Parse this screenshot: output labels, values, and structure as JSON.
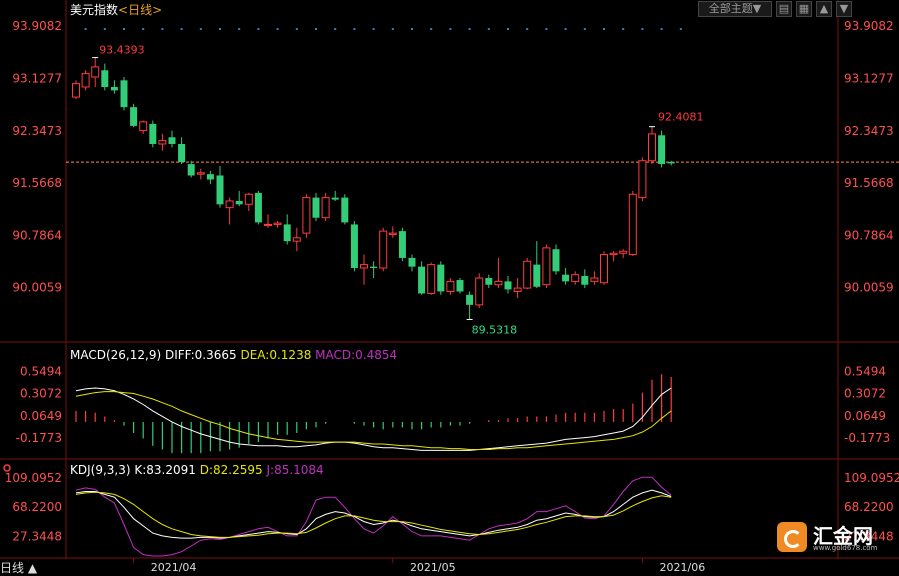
{
  "header": {
    "instrument": "美元指数",
    "period": "<日线>",
    "theme_label": "全部主题▼"
  },
  "price_panel": {
    "y_ticks": [
      "93.9082",
      "93.1277",
      "92.3473",
      "91.5668",
      "90.7864",
      "90.0059"
    ],
    "high_label": "93.4393",
    "low_label": "89.5318",
    "last_high_label": "92.4081",
    "dashed_level": 91.88
  },
  "macd_panel": {
    "title": "MACD(26,12,9)",
    "diff_label": "DIFF:0.3665",
    "dea_label": "DEA:0.1238",
    "macd_label": "MACD:0.4854",
    "y_ticks": [
      "0.5494",
      "0.3072",
      "0.0649",
      "-0.1773"
    ]
  },
  "kdj_panel": {
    "title": "KDJ(9,3,3)",
    "k_label": "K:83.2091",
    "d_label": "D:82.2595",
    "j_label": "J:85.1084",
    "y_ticks": [
      "109.0952",
      "68.2200",
      "27.3448"
    ]
  },
  "x_axis": {
    "labels": [
      "2021/04",
      "2021/05",
      "2021/06"
    ]
  },
  "bottom_tab": "日线 ▲",
  "logo": {
    "name": "汇金网",
    "url": "www.gold678.com"
  },
  "colors": {
    "up": "#ff3b3b",
    "down": "#33cc77",
    "diff": "#ffffff",
    "dea": "#e6e600",
    "macd": "#c030c0",
    "k": "#ffffff",
    "d": "#e6e600",
    "j": "#c030c0"
  },
  "chart_data": {
    "type": "candlestick",
    "price": {
      "ylim": [
        89.3,
        94.0
      ],
      "candles": [
        {
          "o": 92.85,
          "h": 93.1,
          "l": 92.82,
          "c": 93.05
        },
        {
          "o": 93.0,
          "h": 93.25,
          "l": 92.95,
          "c": 93.2
        },
        {
          "o": 93.15,
          "h": 93.44,
          "l": 93.0,
          "c": 93.3
        },
        {
          "o": 93.25,
          "h": 93.35,
          "l": 92.95,
          "c": 93.0
        },
        {
          "o": 93.0,
          "h": 93.1,
          "l": 92.9,
          "c": 92.95
        },
        {
          "o": 93.1,
          "h": 93.15,
          "l": 92.65,
          "c": 92.7
        },
        {
          "o": 92.7,
          "h": 92.75,
          "l": 92.4,
          "c": 92.42
        },
        {
          "o": 92.35,
          "h": 92.5,
          "l": 92.3,
          "c": 92.48
        },
        {
          "o": 92.45,
          "h": 92.5,
          "l": 92.1,
          "c": 92.15
        },
        {
          "o": 92.15,
          "h": 92.3,
          "l": 92.05,
          "c": 92.2
        },
        {
          "o": 92.25,
          "h": 92.35,
          "l": 92.1,
          "c": 92.15
        },
        {
          "o": 92.15,
          "h": 92.25,
          "l": 91.85,
          "c": 91.88
        },
        {
          "o": 91.85,
          "h": 91.9,
          "l": 91.65,
          "c": 91.68
        },
        {
          "o": 91.7,
          "h": 91.78,
          "l": 91.62,
          "c": 91.72
        },
        {
          "o": 91.7,
          "h": 91.75,
          "l": 91.55,
          "c": 91.62
        },
        {
          "o": 91.68,
          "h": 91.82,
          "l": 91.2,
          "c": 91.25
        },
        {
          "o": 91.2,
          "h": 91.35,
          "l": 90.95,
          "c": 91.3
        },
        {
          "o": 91.3,
          "h": 91.45,
          "l": 91.22,
          "c": 91.25
        },
        {
          "o": 91.25,
          "h": 91.42,
          "l": 91.15,
          "c": 91.4
        },
        {
          "o": 91.42,
          "h": 91.45,
          "l": 90.95,
          "c": 90.98
        },
        {
          "o": 90.95,
          "h": 91.1,
          "l": 90.9,
          "c": 90.95
        },
        {
          "o": 90.95,
          "h": 91.0,
          "l": 90.9,
          "c": 90.97
        },
        {
          "o": 90.95,
          "h": 91.1,
          "l": 90.65,
          "c": 90.7
        },
        {
          "o": 90.7,
          "h": 90.9,
          "l": 90.55,
          "c": 90.75
        },
        {
          "o": 90.82,
          "h": 91.4,
          "l": 90.75,
          "c": 91.35
        },
        {
          "o": 91.35,
          "h": 91.42,
          "l": 91.0,
          "c": 91.05
        },
        {
          "o": 91.05,
          "h": 91.42,
          "l": 91.0,
          "c": 91.35
        },
        {
          "o": 91.35,
          "h": 91.45,
          "l": 91.3,
          "c": 91.32
        },
        {
          "o": 91.35,
          "h": 91.4,
          "l": 90.95,
          "c": 90.98
        },
        {
          "o": 90.95,
          "h": 91.0,
          "l": 90.25,
          "c": 90.3
        },
        {
          "o": 90.3,
          "h": 90.5,
          "l": 90.05,
          "c": 90.35
        },
        {
          "o": 90.32,
          "h": 90.4,
          "l": 90.15,
          "c": 90.3
        },
        {
          "o": 90.3,
          "h": 90.9,
          "l": 90.25,
          "c": 90.85
        },
        {
          "o": 90.8,
          "h": 90.92,
          "l": 90.75,
          "c": 90.82
        },
        {
          "o": 90.85,
          "h": 90.9,
          "l": 90.4,
          "c": 90.45
        },
        {
          "o": 90.45,
          "h": 90.5,
          "l": 90.25,
          "c": 90.32
        },
        {
          "o": 90.32,
          "h": 90.4,
          "l": 89.9,
          "c": 89.92
        },
        {
          "o": 89.92,
          "h": 90.38,
          "l": 89.9,
          "c": 90.35
        },
        {
          "o": 90.35,
          "h": 90.4,
          "l": 89.9,
          "c": 89.95
        },
        {
          "o": 89.95,
          "h": 90.15,
          "l": 89.9,
          "c": 90.1
        },
        {
          "o": 90.12,
          "h": 90.15,
          "l": 89.92,
          "c": 89.95
        },
        {
          "o": 89.9,
          "h": 89.95,
          "l": 89.53,
          "c": 89.75
        },
        {
          "o": 89.75,
          "h": 90.22,
          "l": 89.7,
          "c": 90.15
        },
        {
          "o": 90.15,
          "h": 90.2,
          "l": 90.0,
          "c": 90.05
        },
        {
          "o": 90.05,
          "h": 90.45,
          "l": 90.0,
          "c": 90.1
        },
        {
          "o": 90.1,
          "h": 90.18,
          "l": 89.92,
          "c": 89.98
        },
        {
          "o": 89.95,
          "h": 90.15,
          "l": 89.85,
          "c": 90.0
        },
        {
          "o": 90.0,
          "h": 90.45,
          "l": 89.98,
          "c": 90.4
        },
        {
          "o": 90.35,
          "h": 90.7,
          "l": 90.0,
          "c": 90.02
        },
        {
          "o": 90.05,
          "h": 90.65,
          "l": 90.0,
          "c": 90.6
        },
        {
          "o": 90.58,
          "h": 90.65,
          "l": 90.2,
          "c": 90.25
        },
        {
          "o": 90.2,
          "h": 90.3,
          "l": 90.05,
          "c": 90.1
        },
        {
          "o": 90.1,
          "h": 90.25,
          "l": 90.05,
          "c": 90.2
        },
        {
          "o": 90.18,
          "h": 90.28,
          "l": 90.0,
          "c": 90.05
        },
        {
          "o": 90.1,
          "h": 90.25,
          "l": 90.05,
          "c": 90.15
        },
        {
          "o": 90.08,
          "h": 90.55,
          "l": 90.05,
          "c": 90.5
        },
        {
          "o": 90.5,
          "h": 90.55,
          "l": 90.4,
          "c": 90.52
        },
        {
          "o": 90.52,
          "h": 90.58,
          "l": 90.45,
          "c": 90.55
        },
        {
          "o": 90.5,
          "h": 91.45,
          "l": 90.48,
          "c": 91.4
        },
        {
          "o": 91.35,
          "h": 91.95,
          "l": 91.3,
          "c": 91.9
        },
        {
          "o": 91.9,
          "h": 92.41,
          "l": 91.85,
          "c": 92.3
        },
        {
          "o": 92.28,
          "h": 92.35,
          "l": 91.8,
          "c": 91.85
        },
        {
          "o": 91.88,
          "h": 91.9,
          "l": 91.83,
          "c": 91.86
        }
      ]
    },
    "macd": {
      "ylim": [
        -0.36,
        0.62
      ],
      "diff": [
        0.34,
        0.36,
        0.37,
        0.36,
        0.34,
        0.3,
        0.25,
        0.19,
        0.12,
        0.06,
        0.0,
        -0.05,
        -0.09,
        -0.13,
        -0.16,
        -0.19,
        -0.22,
        -0.24,
        -0.25,
        -0.26,
        -0.26,
        -0.26,
        -0.27,
        -0.27,
        -0.26,
        -0.25,
        -0.23,
        -0.22,
        -0.22,
        -0.23,
        -0.25,
        -0.27,
        -0.28,
        -0.28,
        -0.29,
        -0.3,
        -0.31,
        -0.31,
        -0.31,
        -0.31,
        -0.31,
        -0.31,
        -0.3,
        -0.29,
        -0.28,
        -0.27,
        -0.26,
        -0.25,
        -0.24,
        -0.23,
        -0.21,
        -0.19,
        -0.18,
        -0.17,
        -0.16,
        -0.14,
        -0.12,
        -0.1,
        -0.05,
        0.05,
        0.18,
        0.3,
        0.37
      ],
      "dea": [
        0.28,
        0.3,
        0.32,
        0.33,
        0.33,
        0.32,
        0.31,
        0.28,
        0.25,
        0.21,
        0.17,
        0.12,
        0.08,
        0.04,
        0.0,
        -0.03,
        -0.07,
        -0.1,
        -0.13,
        -0.15,
        -0.17,
        -0.19,
        -0.2,
        -0.21,
        -0.22,
        -0.22,
        -0.22,
        -0.22,
        -0.22,
        -0.22,
        -0.23,
        -0.24,
        -0.24,
        -0.25,
        -0.26,
        -0.26,
        -0.27,
        -0.28,
        -0.28,
        -0.29,
        -0.29,
        -0.3,
        -0.3,
        -0.3,
        -0.29,
        -0.29,
        -0.28,
        -0.28,
        -0.27,
        -0.26,
        -0.25,
        -0.24,
        -0.23,
        -0.22,
        -0.21,
        -0.2,
        -0.19,
        -0.17,
        -0.15,
        -0.11,
        -0.05,
        0.04,
        0.12
      ],
      "macd": [
        0.12,
        0.12,
        0.1,
        0.06,
        0.02,
        -0.04,
        -0.12,
        -0.18,
        -0.26,
        -0.3,
        -0.34,
        -0.34,
        -0.34,
        -0.34,
        -0.32,
        -0.32,
        -0.3,
        -0.28,
        -0.24,
        -0.22,
        -0.18,
        -0.14,
        -0.14,
        -0.12,
        -0.08,
        -0.06,
        -0.02,
        0.0,
        0.0,
        -0.02,
        -0.04,
        -0.06,
        -0.08,
        -0.06,
        -0.06,
        -0.08,
        -0.08,
        -0.06,
        -0.06,
        -0.04,
        -0.04,
        -0.02,
        0.0,
        0.02,
        0.02,
        0.04,
        0.04,
        0.06,
        0.06,
        0.06,
        0.08,
        0.1,
        0.1,
        0.1,
        0.1,
        0.12,
        0.14,
        0.14,
        0.2,
        0.32,
        0.46,
        0.52,
        0.49
      ]
    },
    "kdj": {
      "ylim": [
        0,
        120
      ],
      "k": [
        88,
        90,
        90,
        86,
        82,
        68,
        52,
        42,
        32,
        28,
        26,
        25,
        25,
        26,
        26,
        25,
        26,
        28,
        30,
        32,
        34,
        33,
        31,
        30,
        38,
        52,
        58,
        62,
        60,
        55,
        48,
        44,
        46,
        50,
        47,
        42,
        38,
        36,
        34,
        32,
        30,
        28,
        30,
        33,
        36,
        38,
        40,
        44,
        50,
        52,
        56,
        60,
        58,
        55,
        54,
        55,
        62,
        72,
        82,
        88,
        92,
        88,
        83
      ],
      "d": [
        86,
        88,
        89,
        88,
        86,
        80,
        72,
        62,
        52,
        44,
        38,
        34,
        30,
        28,
        27,
        26,
        26,
        27,
        28,
        29,
        31,
        32,
        32,
        31,
        33,
        39,
        46,
        52,
        56,
        56,
        53,
        50,
        48,
        48,
        48,
        46,
        43,
        40,
        37,
        35,
        33,
        31,
        30,
        31,
        33,
        35,
        37,
        40,
        44,
        47,
        51,
        55,
        56,
        56,
        55,
        55,
        57,
        63,
        70,
        76,
        81,
        84,
        82
      ],
      "j": [
        92,
        95,
        93,
        82,
        74,
        44,
        12,
        2,
        0,
        0,
        2,
        6,
        14,
        22,
        24,
        23,
        26,
        30,
        34,
        38,
        40,
        34,
        28,
        28,
        48,
        78,
        82,
        82,
        68,
        52,
        38,
        32,
        42,
        55,
        45,
        34,
        28,
        28,
        28,
        26,
        24,
        22,
        30,
        38,
        42,
        44,
        46,
        52,
        62,
        62,
        66,
        70,
        62,
        53,
        52,
        56,
        72,
        90,
        105,
        110,
        110,
        96,
        85
      ]
    }
  }
}
